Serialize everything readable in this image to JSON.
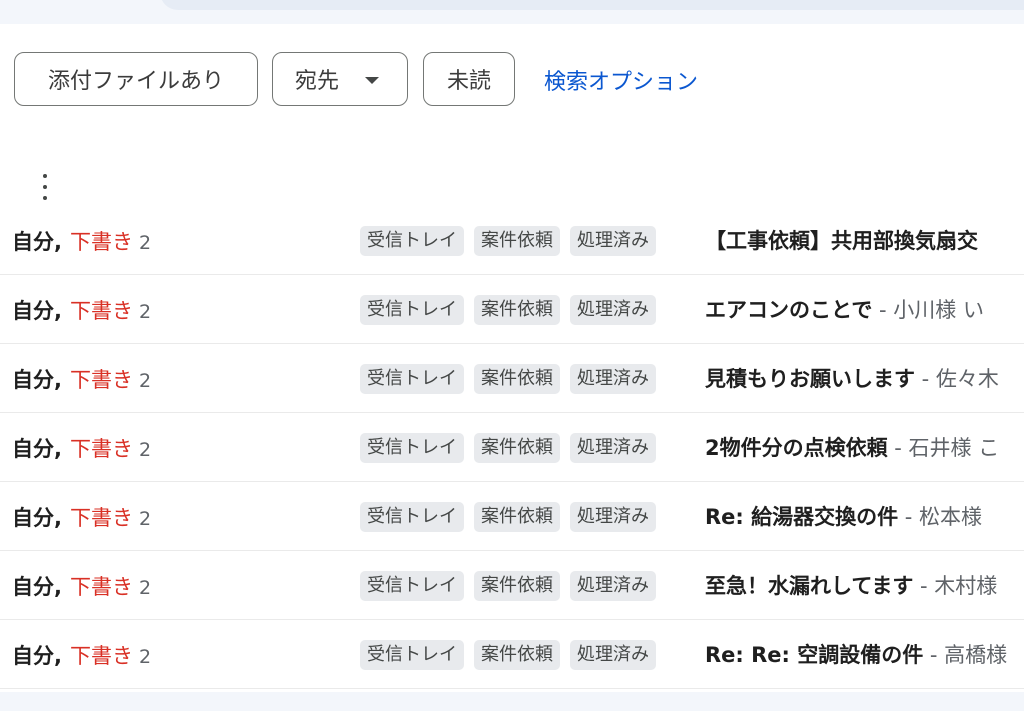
{
  "filters": {
    "attachment": "添付ファイルあり",
    "recipient": "宛先",
    "unread": "未読",
    "search_options": "検索オプション"
  },
  "icons": {
    "more": "more-vert-icon",
    "recipient_caret": "caret-down-icon"
  },
  "colors": {
    "draft": "#d93025",
    "link": "#0b57d0",
    "label_bg": "#e8eaed"
  },
  "threads": [
    {
      "sender": "自分",
      "sep": ",",
      "draft": "下書き",
      "count": "2",
      "labels": [
        "受信トレイ",
        "案件依頼",
        "処理済み"
      ],
      "subject": "【工事依頼】共用部換気扇交",
      "snippet": ""
    },
    {
      "sender": "自分",
      "sep": ",",
      "draft": "下書き",
      "count": "2",
      "labels": [
        "受信トレイ",
        "案件依頼",
        "処理済み"
      ],
      "subject": "エアコンのことで",
      "snippet": " - 小川様 い"
    },
    {
      "sender": "自分",
      "sep": ",",
      "draft": "下書き",
      "count": "2",
      "labels": [
        "受信トレイ",
        "案件依頼",
        "処理済み"
      ],
      "subject": "見積もりお願いします",
      "snippet": " - 佐々木"
    },
    {
      "sender": "自分",
      "sep": ",",
      "draft": "下書き",
      "count": "2",
      "labels": [
        "受信トレイ",
        "案件依頼",
        "処理済み"
      ],
      "subject": "2物件分の点検依頼",
      "snippet": " - 石井様 こ"
    },
    {
      "sender": "自分",
      "sep": ",",
      "draft": "下書き",
      "count": "2",
      "labels": [
        "受信トレイ",
        "案件依頼",
        "処理済み"
      ],
      "subject": "Re: 給湯器交換の件",
      "snippet": " - 松本様"
    },
    {
      "sender": "自分",
      "sep": ",",
      "draft": "下書き",
      "count": "2",
      "labels": [
        "受信トレイ",
        "案件依頼",
        "処理済み"
      ],
      "subject": "至急！水漏れしてます",
      "snippet": " - 木村様"
    },
    {
      "sender": "自分",
      "sep": ",",
      "draft": "下書き",
      "count": "2",
      "labels": [
        "受信トレイ",
        "案件依頼",
        "処理済み"
      ],
      "subject": "Re: Re: 空調設備の件",
      "snippet": " - 高橋様"
    }
  ]
}
